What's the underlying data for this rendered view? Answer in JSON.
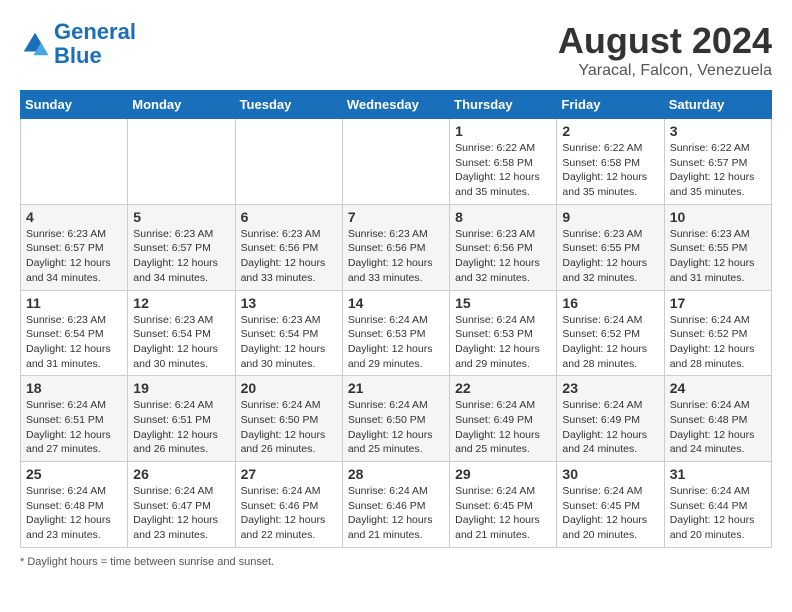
{
  "header": {
    "logo_line1": "General",
    "logo_line2": "Blue",
    "title": "August 2024",
    "subtitle": "Yaracal, Falcon, Venezuela"
  },
  "footer": {
    "note": "Daylight hours"
  },
  "days_of_week": [
    "Sunday",
    "Monday",
    "Tuesday",
    "Wednesday",
    "Thursday",
    "Friday",
    "Saturday"
  ],
  "weeks": [
    [
      {
        "day": "",
        "sunrise": "",
        "sunset": "",
        "daylight": ""
      },
      {
        "day": "",
        "sunrise": "",
        "sunset": "",
        "daylight": ""
      },
      {
        "day": "",
        "sunrise": "",
        "sunset": "",
        "daylight": ""
      },
      {
        "day": "",
        "sunrise": "",
        "sunset": "",
        "daylight": ""
      },
      {
        "day": "1",
        "sunrise": "Sunrise: 6:22 AM",
        "sunset": "Sunset: 6:58 PM",
        "daylight": "Daylight: 12 hours and 35 minutes."
      },
      {
        "day": "2",
        "sunrise": "Sunrise: 6:22 AM",
        "sunset": "Sunset: 6:58 PM",
        "daylight": "Daylight: 12 hours and 35 minutes."
      },
      {
        "day": "3",
        "sunrise": "Sunrise: 6:22 AM",
        "sunset": "Sunset: 6:57 PM",
        "daylight": "Daylight: 12 hours and 35 minutes."
      }
    ],
    [
      {
        "day": "4",
        "sunrise": "Sunrise: 6:23 AM",
        "sunset": "Sunset: 6:57 PM",
        "daylight": "Daylight: 12 hours and 34 minutes."
      },
      {
        "day": "5",
        "sunrise": "Sunrise: 6:23 AM",
        "sunset": "Sunset: 6:57 PM",
        "daylight": "Daylight: 12 hours and 34 minutes."
      },
      {
        "day": "6",
        "sunrise": "Sunrise: 6:23 AM",
        "sunset": "Sunset: 6:56 PM",
        "daylight": "Daylight: 12 hours and 33 minutes."
      },
      {
        "day": "7",
        "sunrise": "Sunrise: 6:23 AM",
        "sunset": "Sunset: 6:56 PM",
        "daylight": "Daylight: 12 hours and 33 minutes."
      },
      {
        "day": "8",
        "sunrise": "Sunrise: 6:23 AM",
        "sunset": "Sunset: 6:56 PM",
        "daylight": "Daylight: 12 hours and 32 minutes."
      },
      {
        "day": "9",
        "sunrise": "Sunrise: 6:23 AM",
        "sunset": "Sunset: 6:55 PM",
        "daylight": "Daylight: 12 hours and 32 minutes."
      },
      {
        "day": "10",
        "sunrise": "Sunrise: 6:23 AM",
        "sunset": "Sunset: 6:55 PM",
        "daylight": "Daylight: 12 hours and 31 minutes."
      }
    ],
    [
      {
        "day": "11",
        "sunrise": "Sunrise: 6:23 AM",
        "sunset": "Sunset: 6:54 PM",
        "daylight": "Daylight: 12 hours and 31 minutes."
      },
      {
        "day": "12",
        "sunrise": "Sunrise: 6:23 AM",
        "sunset": "Sunset: 6:54 PM",
        "daylight": "Daylight: 12 hours and 30 minutes."
      },
      {
        "day": "13",
        "sunrise": "Sunrise: 6:23 AM",
        "sunset": "Sunset: 6:54 PM",
        "daylight": "Daylight: 12 hours and 30 minutes."
      },
      {
        "day": "14",
        "sunrise": "Sunrise: 6:24 AM",
        "sunset": "Sunset: 6:53 PM",
        "daylight": "Daylight: 12 hours and 29 minutes."
      },
      {
        "day": "15",
        "sunrise": "Sunrise: 6:24 AM",
        "sunset": "Sunset: 6:53 PM",
        "daylight": "Daylight: 12 hours and 29 minutes."
      },
      {
        "day": "16",
        "sunrise": "Sunrise: 6:24 AM",
        "sunset": "Sunset: 6:52 PM",
        "daylight": "Daylight: 12 hours and 28 minutes."
      },
      {
        "day": "17",
        "sunrise": "Sunrise: 6:24 AM",
        "sunset": "Sunset: 6:52 PM",
        "daylight": "Daylight: 12 hours and 28 minutes."
      }
    ],
    [
      {
        "day": "18",
        "sunrise": "Sunrise: 6:24 AM",
        "sunset": "Sunset: 6:51 PM",
        "daylight": "Daylight: 12 hours and 27 minutes."
      },
      {
        "day": "19",
        "sunrise": "Sunrise: 6:24 AM",
        "sunset": "Sunset: 6:51 PM",
        "daylight": "Daylight: 12 hours and 26 minutes."
      },
      {
        "day": "20",
        "sunrise": "Sunrise: 6:24 AM",
        "sunset": "Sunset: 6:50 PM",
        "daylight": "Daylight: 12 hours and 26 minutes."
      },
      {
        "day": "21",
        "sunrise": "Sunrise: 6:24 AM",
        "sunset": "Sunset: 6:50 PM",
        "daylight": "Daylight: 12 hours and 25 minutes."
      },
      {
        "day": "22",
        "sunrise": "Sunrise: 6:24 AM",
        "sunset": "Sunset: 6:49 PM",
        "daylight": "Daylight: 12 hours and 25 minutes."
      },
      {
        "day": "23",
        "sunrise": "Sunrise: 6:24 AM",
        "sunset": "Sunset: 6:49 PM",
        "daylight": "Daylight: 12 hours and 24 minutes."
      },
      {
        "day": "24",
        "sunrise": "Sunrise: 6:24 AM",
        "sunset": "Sunset: 6:48 PM",
        "daylight": "Daylight: 12 hours and 24 minutes."
      }
    ],
    [
      {
        "day": "25",
        "sunrise": "Sunrise: 6:24 AM",
        "sunset": "Sunset: 6:48 PM",
        "daylight": "Daylight: 12 hours and 23 minutes."
      },
      {
        "day": "26",
        "sunrise": "Sunrise: 6:24 AM",
        "sunset": "Sunset: 6:47 PM",
        "daylight": "Daylight: 12 hours and 23 minutes."
      },
      {
        "day": "27",
        "sunrise": "Sunrise: 6:24 AM",
        "sunset": "Sunset: 6:46 PM",
        "daylight": "Daylight: 12 hours and 22 minutes."
      },
      {
        "day": "28",
        "sunrise": "Sunrise: 6:24 AM",
        "sunset": "Sunset: 6:46 PM",
        "daylight": "Daylight: 12 hours and 21 minutes."
      },
      {
        "day": "29",
        "sunrise": "Sunrise: 6:24 AM",
        "sunset": "Sunset: 6:45 PM",
        "daylight": "Daylight: 12 hours and 21 minutes."
      },
      {
        "day": "30",
        "sunrise": "Sunrise: 6:24 AM",
        "sunset": "Sunset: 6:45 PM",
        "daylight": "Daylight: 12 hours and 20 minutes."
      },
      {
        "day": "31",
        "sunrise": "Sunrise: 6:24 AM",
        "sunset": "Sunset: 6:44 PM",
        "daylight": "Daylight: 12 hours and 20 minutes."
      }
    ]
  ]
}
